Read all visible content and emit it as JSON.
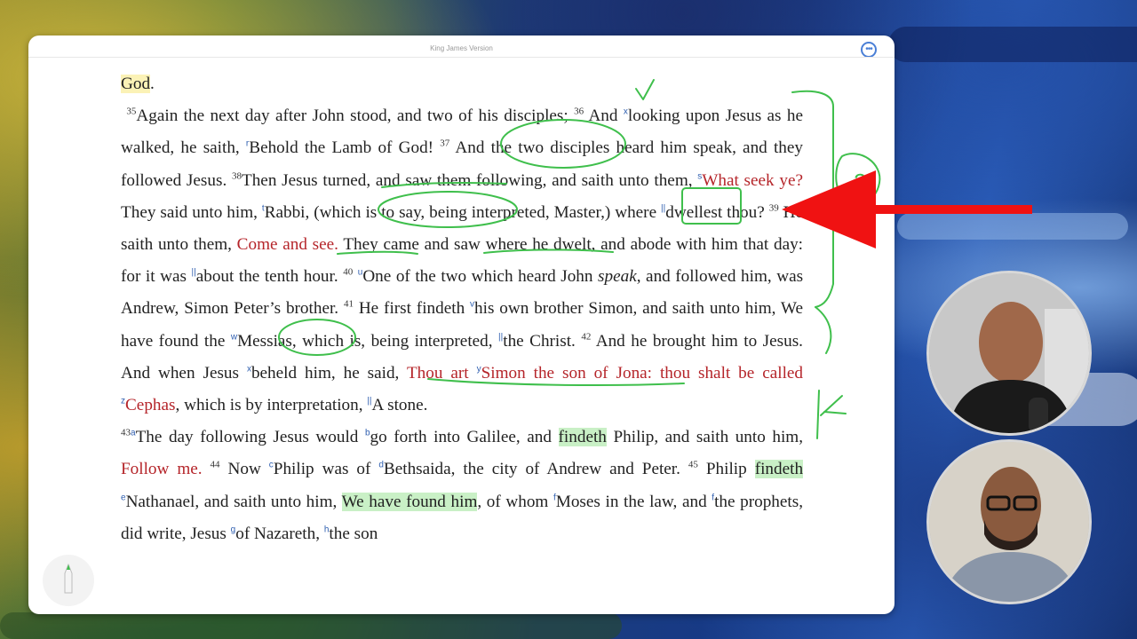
{
  "window": {
    "title": "King James Version"
  },
  "menu": {
    "more_glyph": "•••"
  },
  "scripture": {
    "t0": "God",
    "t1": ".",
    "v35": "35",
    "t2": "Again the next day after John stood, and two of his disciples;",
    "v36": "36",
    "t3": "And",
    "fx": "x",
    "t4": "looking upon Jesus as he walked, he saith,",
    "fr": "r",
    "t5": "Behold the Lamb of God!",
    "v37": "37",
    "t6": "And the two disciples heard him speak, and they followed Jesus.",
    "v38": "38",
    "t7": "Then Jesus turned, and saw them following, and saith unto them,",
    "fs": "s",
    "t8": "What seek ye?",
    "t9": "They said unto him,",
    "ft": "t",
    "t10": "Rabbi, (which is to say, being interpreted, Master,) where",
    "fbar1": "||",
    "t11": "dwellest thou?",
    "v39": "39",
    "t12": "He saith unto them,",
    "t13": "Come and see.",
    "t14": "They came and saw where he dwelt, and abode with him that day: for it was",
    "fbar2": "||",
    "t15": "about the tenth hour.",
    "v40": "40",
    "fu": "u",
    "t16": "One of the two which heard John",
    "t16i": "speak",
    "t17": ", and followed him, was Andrew, Simon Peter’s brother.",
    "v41": "41",
    "t18": "He first findeth",
    "fv": "v",
    "t19": "his own brother Simon, and saith unto him, We have found the",
    "fw": "w",
    "t20": "Messias, which is, being interpreted,",
    "fbar3": "||",
    "t21": "the Christ.",
    "v42": "42",
    "t22": "And he brought him to Jesus. And when Jesus",
    "fx2": "x",
    "t23": "beheld him, he said,",
    "t24": "Thou art",
    "fy": "y",
    "t25": "Simon the son of Jona: thou shalt be called",
    "fz": "z",
    "t26": "Cephas",
    "t27": ", which is by interpretation,",
    "fbar4": "||",
    "t28": "A stone.",
    "v43": "43",
    "fa": "a",
    "t29": "The day following Jesus would",
    "fb": "b",
    "t30": "go forth into Galilee, and",
    "t31": "findeth",
    "t32": "Philip, and saith unto him,",
    "t33": "Follow me.",
    "v44": "44",
    "t34": "Now",
    "fc": "c",
    "t35": "Philip was of",
    "fd": "d",
    "t36": "Bethsaida, the city of Andrew and Peter.",
    "v45": "45",
    "t37": "Philip",
    "t38": "findeth",
    "fe": "e",
    "t39": "Nathanael, and saith unto him,",
    "t40": "We have found him",
    "t41": ", of whom",
    "ff": "f",
    "t42": "Moses in the law, and",
    "ff2": "f",
    "t43": "the prophets, did write, Jesus",
    "fg": "g",
    "t44": "of Nazareth,",
    "fh": "h",
    "t45": "the son"
  },
  "annotations": {
    "note_number": "2",
    "ink_color": "#3fbf4c",
    "arrow_color": "#f01212"
  },
  "colors": {
    "words_of_christ": "#b5252a",
    "highlight_yellow": "#fbf2b6",
    "highlight_green": "#c9f0c6",
    "footnote": "#2f5fb0"
  }
}
